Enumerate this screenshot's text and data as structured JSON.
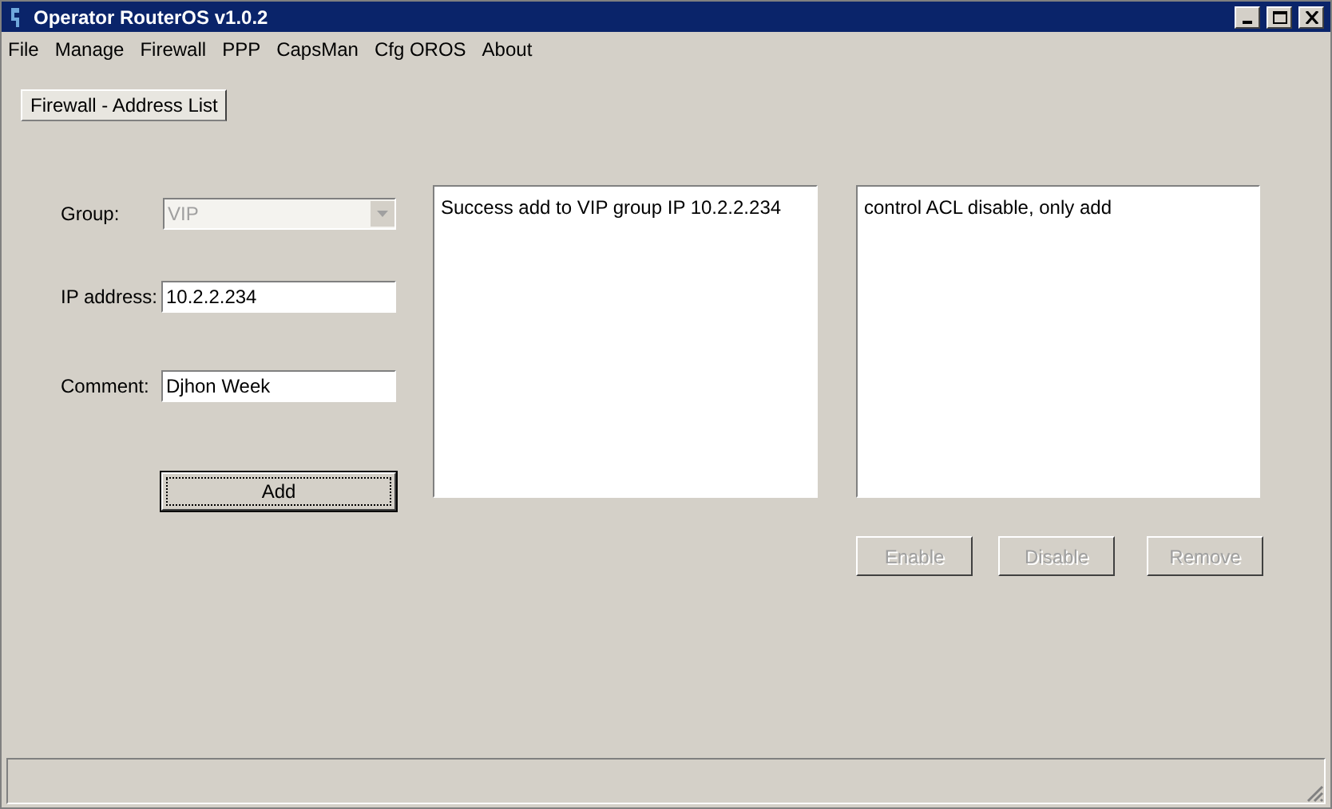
{
  "window": {
    "title": "Operator RouterOS v1.0.2"
  },
  "menu": [
    "File",
    "Manage",
    "Firewall",
    "PPP",
    "CapsMan",
    "Cfg OROS",
    "About"
  ],
  "tabs": [
    {
      "label": "Firewall - Address List",
      "selected": true
    }
  ],
  "form": {
    "group": {
      "label": "Group:",
      "value": "VIP",
      "disabled": true
    },
    "ip": {
      "label": "IP address:",
      "value": "10.2.2.234"
    },
    "comment": {
      "label": "Comment:",
      "value": "Djhon Week"
    },
    "add_button": {
      "label": "Add",
      "focused": true
    }
  },
  "result_box": {
    "text": "Success add to VIP group IP 10.2.2.234"
  },
  "acl_box": {
    "text": "control ACL disable, only add"
  },
  "buttons": [
    {
      "label": "Enable",
      "disabled": true
    },
    {
      "label": "Disable",
      "disabled": true
    },
    {
      "label": "Remove",
      "disabled": true
    }
  ]
}
